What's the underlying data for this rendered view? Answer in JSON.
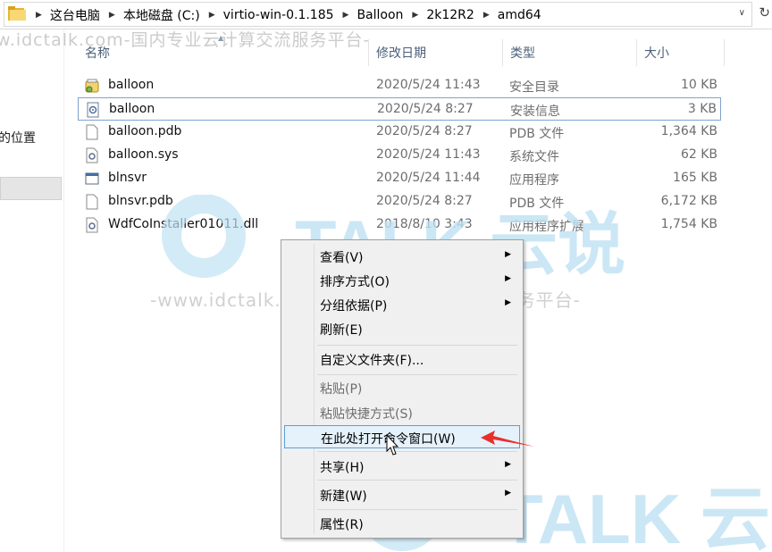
{
  "breadcrumb": [
    "这台电脑",
    "本地磁盘 (C:)",
    "virtio-win-0.1.185",
    "Balloon",
    "2k12R2",
    "amd64"
  ],
  "nav": {
    "location_label": "的位置"
  },
  "columns": {
    "name": "名称",
    "date": "修改日期",
    "type": "类型",
    "size": "大小"
  },
  "files": [
    {
      "name": "balloon",
      "date": "2020/5/24 11:43",
      "type": "安全目录",
      "size": "10 KB",
      "icon": "security-catalog-icon"
    },
    {
      "name": "balloon",
      "date": "2020/5/24 8:27",
      "type": "安装信息",
      "size": "3 KB",
      "icon": "setup-info-icon"
    },
    {
      "name": "balloon.pdb",
      "date": "2020/5/24 8:27",
      "type": "PDB 文件",
      "size": "1,364 KB",
      "icon": "file-icon"
    },
    {
      "name": "balloon.sys",
      "date": "2020/5/24 11:43",
      "type": "系统文件",
      "size": "62 KB",
      "icon": "system-file-icon"
    },
    {
      "name": "blnsvr",
      "date": "2020/5/24 11:44",
      "type": "应用程序",
      "size": "165 KB",
      "icon": "application-icon"
    },
    {
      "name": "blnsvr.pdb",
      "date": "2020/5/24 8:27",
      "type": "PDB 文件",
      "size": "6,172 KB",
      "icon": "file-icon"
    },
    {
      "name": "WdfCoInstaller01011.dll",
      "date": "2018/8/10 3:43",
      "type": "应用程序扩展",
      "size": "1,754 KB",
      "icon": "dll-icon"
    }
  ],
  "context_menu": {
    "view": "查看(V)",
    "sort": "排序方式(O)",
    "group": "分组依据(P)",
    "refresh": "刷新(E)",
    "customize": "自定义文件夹(F)...",
    "paste": "粘贴(P)",
    "paste_shortcut": "粘贴快捷方式(S)",
    "open_cmd": "在此处打开命令窗口(W)",
    "share": "共享(H)",
    "new": "新建(W)",
    "properties": "属性(R)"
  },
  "watermarks": {
    "top": "w.idctalk.com-国内专业云计算交流服务平台-",
    "middle": "-www.idctalk.com-国内专业云计算交流服务平台-",
    "logo1": "TALK 云说",
    "logo2": "TALK 云"
  },
  "colors": {
    "accent": "#5d9fd6",
    "header_text": "#4c607a",
    "arrow_red": "#e8302a",
    "watermark_blue": "#bfe2f3"
  }
}
